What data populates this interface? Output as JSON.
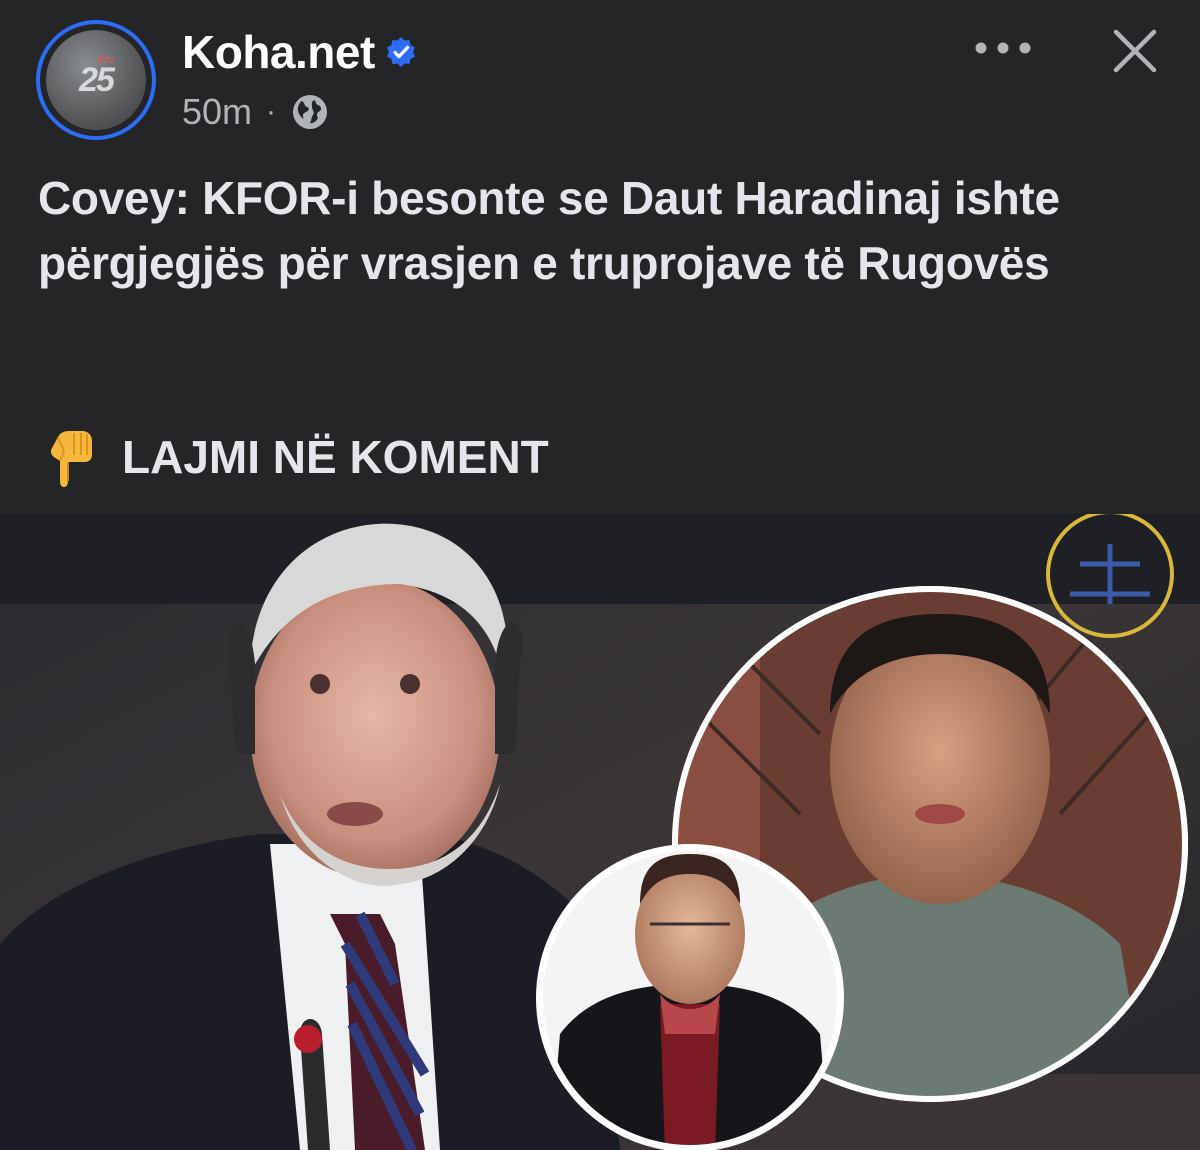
{
  "post": {
    "page_name": "Koha.net",
    "verified_icon": "verified-badge-icon",
    "time_ago": "50m",
    "separator": "·",
    "audience_icon": "globe-icon",
    "avatar": {
      "text": "25",
      "small_text": "KTV"
    },
    "headline": "Covey: KFOR-i besonte se Daut Haradinaj ishte përgjegjës për vrasjen e truprojave të Rugovës",
    "cta_icon": "pointing-down-hand-icon",
    "cta_text": "LAJMI NË KOMENT"
  },
  "actions": {
    "more_icon": "more-options-icon",
    "close_icon": "close-icon"
  },
  "colors": {
    "background": "#242526",
    "text_primary": "#e4e6eb",
    "text_secondary": "#b0b3b8",
    "verified_blue": "#2d6df6",
    "avatar_ring": "#2d6df6"
  }
}
